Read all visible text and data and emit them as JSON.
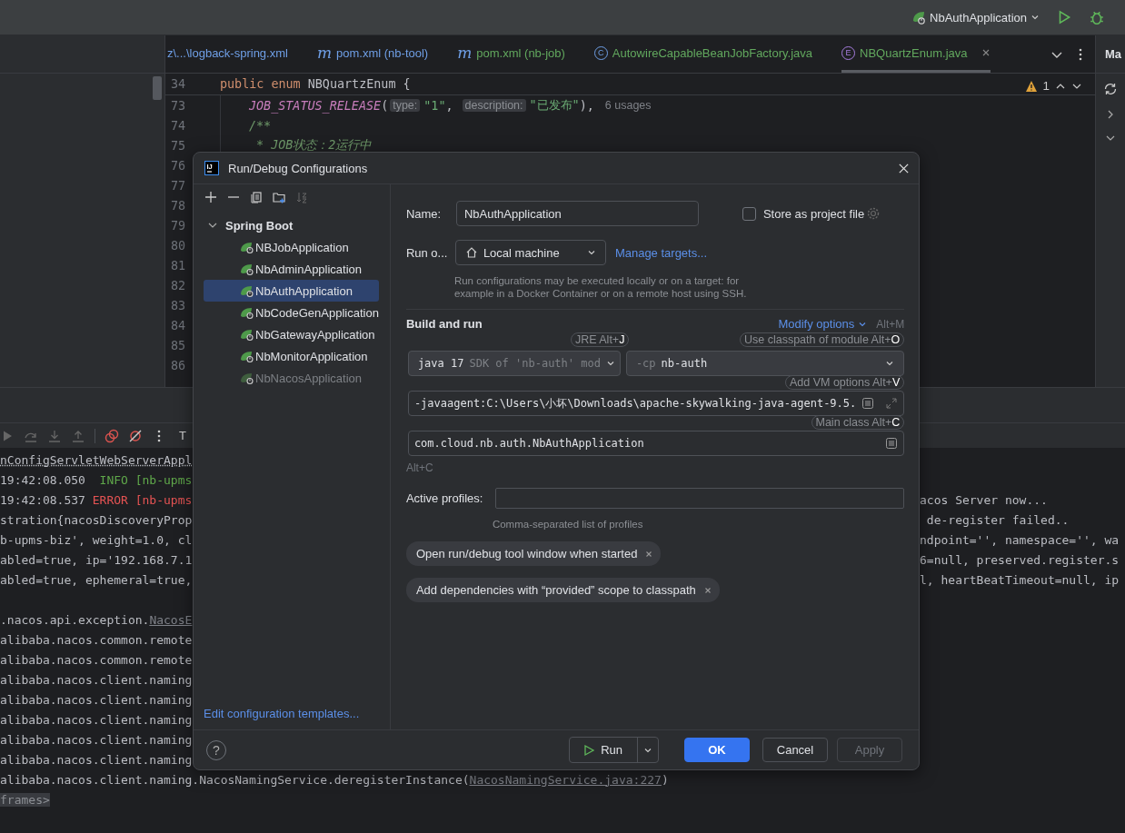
{
  "toolbar": {
    "run_config": "NbAuthApplication"
  },
  "editor_tabs": [
    {
      "label": "z\\...\\logback-spring.xml",
      "kind": "file",
      "color": "#6f9fe6",
      "selected": false
    },
    {
      "label": "pom.xml (nb-tool)",
      "kind": "maven",
      "badge": "m",
      "color": "#6f9fe6",
      "selected": false
    },
    {
      "label": "pom.xml (nb-job)",
      "kind": "maven",
      "badge": "m",
      "color": "#62a85e",
      "selected": false
    },
    {
      "label": "AutowireCapableBeanJobFactory.java",
      "kind": "class",
      "badge": "C",
      "color": "#62a85e",
      "selected": false
    },
    {
      "label": "NBQuartzEnum.java",
      "kind": "enum",
      "badge": "E",
      "color": "#62a85e",
      "selected": true
    }
  ],
  "side_tab": "Ma",
  "warning_count": "1",
  "sticky_line": {
    "num": "34",
    "segments": [
      {
        "text": "public ",
        "kind": "keyword"
      },
      {
        "text": "enum ",
        "kind": "keyword"
      },
      {
        "text": "NBQuartzEnum {",
        "kind": "plain"
      }
    ]
  },
  "editor_lines": [
    {
      "num": "73",
      "segments": [
        {
          "text": "JOB_STATUS_RELEASE",
          "kind": "const"
        },
        {
          "text": "(",
          "kind": "plain"
        },
        {
          "text": "type:",
          "kind": "hint"
        },
        {
          "text": "\"1\"",
          "kind": "string"
        },
        {
          "text": ", ",
          "kind": "plain"
        },
        {
          "text": "description:",
          "kind": "hint"
        },
        {
          "text": "\"已发布\"",
          "kind": "string"
        },
        {
          "text": "),",
          "kind": "plain"
        },
        {
          "text": "6 usages",
          "kind": "usages"
        }
      ]
    },
    {
      "num": "74",
      "segments": [
        {
          "text": "/**",
          "kind": "comment"
        }
      ]
    },
    {
      "num": "75",
      "segments": [
        {
          "text": " * JOB状态：2运行中",
          "kind": "comment"
        }
      ]
    },
    {
      "num": "76"
    },
    {
      "num": "77"
    },
    {
      "num": "78"
    },
    {
      "num": "79"
    },
    {
      "num": "80"
    },
    {
      "num": "81"
    },
    {
      "num": "82"
    },
    {
      "num": "83"
    },
    {
      "num": "84"
    },
    {
      "num": "85"
    },
    {
      "num": "86"
    }
  ],
  "console_toolbar_label": "T",
  "console_rows": [
    {
      "left": [
        {
          "text": "nConfigServletWebServerAppl",
          "kind": "dotted"
        }
      ]
    },
    {
      "left": [
        {
          "text": "19:42:08.050  ",
          "kind": "plain"
        },
        {
          "text": "INFO [nb-upms",
          "kind": "info"
        }
      ]
    },
    {
      "left": [
        {
          "text": "19:42:08.537 ",
          "kind": "plain"
        },
        {
          "text": "ERROR [nb-upms",
          "kind": "error"
        }
      ],
      "right": "acos Server now..."
    },
    {
      "left": [
        {
          "text": "stration{nacosDiscoveryProp",
          "kind": "plain"
        }
      ],
      "right": " de-register failed.."
    },
    {
      "left": [
        {
          "text": "b-upms-biz', weight=1.0, cl",
          "kind": "plain"
        }
      ],
      "right": "ndpoint='', namespace='', wa"
    },
    {
      "left": [
        {
          "text": "abled=true, ip='192.168.7.1",
          "kind": "plain"
        }
      ],
      "right": "6=null, preserved.register.s"
    },
    {
      "left": [
        {
          "text": "abled=true, ephemeral=true,",
          "kind": "plain"
        }
      ],
      "right": "l, heartBeatTimeout=null, ip"
    },
    {},
    {
      "left": [
        {
          "text": ".nacos.api.exception.",
          "kind": "plain"
        },
        {
          "text": "NacosE",
          "kind": "link"
        }
      ]
    },
    {
      "left": [
        {
          "text": "alibaba.nacos.common.remote",
          "kind": "plain"
        }
      ]
    },
    {
      "left": [
        {
          "text": "alibaba.nacos.common.remote",
          "kind": "plain"
        }
      ]
    },
    {
      "left": [
        {
          "text": "alibaba.nacos.client.naming",
          "kind": "plain"
        }
      ]
    },
    {
      "left": [
        {
          "text": "alibaba.nacos.client.naming",
          "kind": "plain"
        }
      ]
    },
    {
      "left": [
        {
          "text": "alibaba.nacos.client.naming",
          "kind": "plain"
        }
      ]
    },
    {
      "left": [
        {
          "text": "alibaba.nacos.client.naming",
          "kind": "plain"
        }
      ]
    },
    {
      "left": [
        {
          "text": "alibaba.nacos.client.naming",
          "kind": "plain"
        }
      ]
    },
    {
      "left": [
        {
          "text": "alibaba.nacos.client.naming.NacosNamingService.deregisterInstance(",
          "kind": "plain"
        },
        {
          "text": "NacosNamingService.java:227",
          "kind": "link"
        },
        {
          "text": ")",
          "kind": "plain"
        }
      ]
    },
    {
      "left": [
        {
          "text": "frames>",
          "kind": "frames"
        }
      ]
    }
  ],
  "dialog": {
    "logo": "IJ",
    "title": "Run/Debug Configurations",
    "tree": {
      "label": "Spring Boot",
      "expanded": true,
      "children": [
        {
          "label": "NBJobApplication",
          "selected": false,
          "greyed": false
        },
        {
          "label": "NbAdminApplication",
          "selected": false,
          "greyed": false
        },
        {
          "label": "NbAuthApplication",
          "selected": true,
          "greyed": false
        },
        {
          "label": "NbCodeGenApplication",
          "selected": false,
          "greyed": false
        },
        {
          "label": "NbGatewayApplication",
          "selected": false,
          "greyed": false
        },
        {
          "label": "NbMonitorApplication",
          "selected": false,
          "greyed": false
        },
        {
          "label": "NbNacosApplication",
          "selected": false,
          "greyed": true
        }
      ]
    },
    "templates_link": "Edit configuration templates...",
    "name_label": "Name:",
    "name_value": "NbAuthApplication",
    "store": {
      "label": "Store as project file",
      "checked": false
    },
    "run_on_label": "Run o...",
    "run_on_value": "Local machine",
    "manage_link": "Manage targets...",
    "run_on_hint": "Run configurations may be executed locally or on a target: for example in a Docker Container or on a remote host using SSH.",
    "section_title": "Build and run",
    "modify_link": "Modify options",
    "modify_shortcut": "Alt+M",
    "jre": {
      "value": "java 17",
      "detail": "SDK of 'nb-auth' mod"
    },
    "classpath": {
      "prefix": "-cp",
      "value": "nb-auth"
    },
    "vm_options": "-javaagent:C:\\Users\\小坏\\Downloads\\apache-skywalking-java-agent-9.5.",
    "main_class": "com.cloud.nb.auth.NbAuthApplication",
    "main_shortcut": "Alt+C",
    "jre_badge": "JRE Alt+**J**",
    "classpath_badge": "Use classpath of module Alt+**O**",
    "vm_badge": "Add VM options Alt+**V**",
    "main_badge": "Main class Alt+**C**",
    "profiles_label": "Active profiles:",
    "profiles_hint": "Comma-separated list of profiles",
    "chips": [
      "Open run/debug tool window when started",
      "Add dependencies with “provided” scope to classpath"
    ],
    "help": "?",
    "buttons": {
      "run": "Run",
      "ok": "OK",
      "cancel": "Cancel",
      "apply": {
        "label": "Apply",
        "disabled": true
      }
    }
  }
}
